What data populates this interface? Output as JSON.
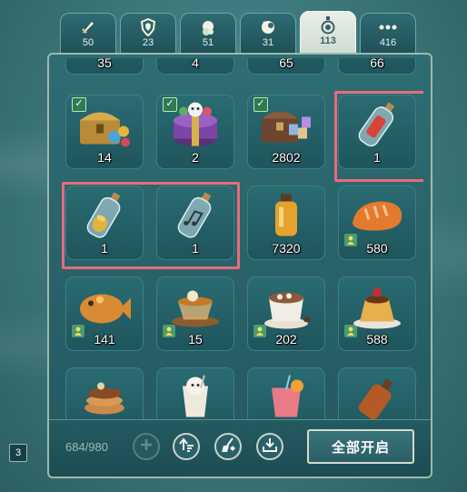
{
  "tabs": [
    {
      "icon": "sword-icon",
      "count": "50",
      "active": false
    },
    {
      "icon": "shield-icon",
      "count": "23",
      "active": false
    },
    {
      "icon": "orb-icon",
      "count": "51",
      "active": false
    },
    {
      "icon": "moon-icon",
      "count": "31",
      "active": false
    },
    {
      "icon": "bottle-icon",
      "count": "113",
      "active": true
    },
    {
      "icon": "more-icon",
      "count": "416",
      "active": false
    }
  ],
  "grid": {
    "row0": [
      {
        "qty": "35"
      },
      {
        "qty": "4"
      },
      {
        "qty": "65"
      },
      {
        "qty": "66"
      }
    ],
    "row1": [
      {
        "qty": "14",
        "checked": true,
        "item": "treasure-chest"
      },
      {
        "qty": "2",
        "checked": true,
        "item": "purple-gift-box"
      },
      {
        "qty": "2802",
        "checked": true,
        "item": "wooden-chest"
      },
      {
        "qty": "1",
        "item": "red-letter-bottle"
      }
    ],
    "row2": [
      {
        "qty": "1",
        "item": "gold-coin-bottle"
      },
      {
        "qty": "1",
        "item": "music-note-bottle"
      },
      {
        "qty": "7320",
        "item": "honey-jar"
      },
      {
        "qty": "580",
        "tag": true,
        "item": "bread-loaf"
      }
    ],
    "row3": [
      {
        "qty": "141",
        "tag": true,
        "item": "fish-bun"
      },
      {
        "qty": "15",
        "tag": true,
        "item": "tea-cup"
      },
      {
        "qty": "202",
        "tag": true,
        "item": "cocoa-mug"
      },
      {
        "qty": "588",
        "tag": true,
        "item": "pudding"
      }
    ],
    "row4": [
      {
        "item": "pancake-stack"
      },
      {
        "item": "milk-drink"
      },
      {
        "item": "juice-glass"
      },
      {
        "item": "sauce-bottle"
      }
    ]
  },
  "bottom": {
    "capacity": "684/980",
    "open_all_label": "全部开启"
  },
  "side_badge": "3"
}
